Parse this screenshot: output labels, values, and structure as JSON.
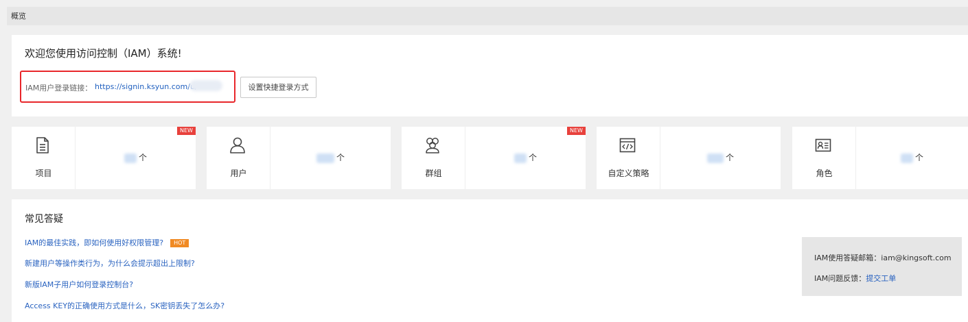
{
  "header": {
    "title": "概览"
  },
  "welcome": {
    "title": "欢迎您使用访问控制（IAM）系统!",
    "login_label": "IAM用户登录链接：",
    "login_url": "https://signin.ksyun.com/u/",
    "quick_login_button": "设置快捷登录方式"
  },
  "cards": [
    {
      "label": "项目",
      "count_unit": "个",
      "badge": "NEW",
      "icon": "document-icon"
    },
    {
      "label": "用户",
      "count_unit": "个",
      "badge": "",
      "icon": "user-icon"
    },
    {
      "label": "群组",
      "count_unit": "个",
      "badge": "NEW",
      "icon": "group-icon"
    },
    {
      "label": "自定义策略",
      "count_unit": "个",
      "badge": "",
      "icon": "code-policy-icon"
    },
    {
      "label": "角色",
      "count_unit": "个",
      "badge": "",
      "icon": "role-card-icon"
    }
  ],
  "faq": {
    "title": "常见答疑",
    "items": [
      "IAM的最佳实践，即如何使用好权限管理?",
      "新建用户等操作类行为，为什么会提示超出上限制?",
      "新版IAM子用户如何登录控制台?",
      "Access KEY的正确使用方式是什么，SK密钥丢失了怎么办?"
    ],
    "hot_badge": "HOT"
  },
  "contact": {
    "email_label": "IAM使用答疑邮箱：",
    "email": "iam@kingsoft.com",
    "feedback_label": "IAM问题反馈：",
    "feedback_link": "提交工单"
  },
  "colors": {
    "link": "#2a63c0",
    "new_badge": "#e8413c",
    "hot_badge": "#f08a24",
    "highlight_box": "#e8262a"
  }
}
